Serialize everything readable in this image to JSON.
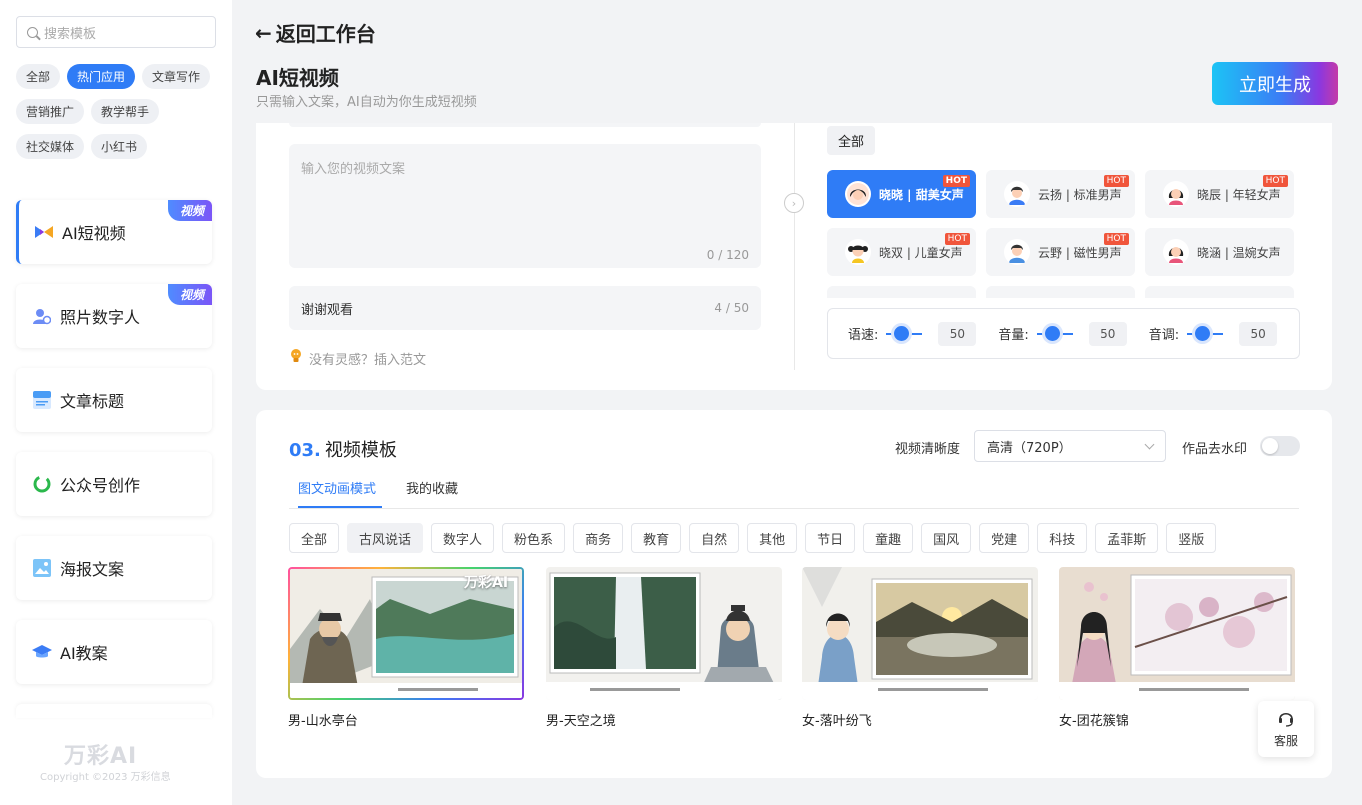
{
  "sidebar": {
    "search_placeholder": "搜索模板",
    "categories": [
      {
        "label": "全部",
        "active": false
      },
      {
        "label": "热门应用",
        "active": true
      },
      {
        "label": "文章写作",
        "active": false
      },
      {
        "label": "营销推广",
        "active": false
      },
      {
        "label": "教学帮手",
        "active": false
      },
      {
        "label": "社交媒体",
        "active": false
      },
      {
        "label": "小红书",
        "active": false
      }
    ],
    "tools": [
      {
        "label": "AI短视频",
        "badge": "视频",
        "icon": "video-icon",
        "active": true
      },
      {
        "label": "照片数字人",
        "badge": "视频",
        "icon": "digital-human-icon",
        "active": false
      },
      {
        "label": "文章标题",
        "badge": "",
        "icon": "title-icon",
        "active": false
      },
      {
        "label": "公众号创作",
        "badge": "",
        "icon": "wechat-icon",
        "active": false
      },
      {
        "label": "海报文案",
        "badge": "",
        "icon": "poster-icon",
        "active": false
      },
      {
        "label": "AI教案",
        "badge": "",
        "icon": "graduation-cap-icon",
        "active": false
      }
    ],
    "brand": "万彩AI",
    "copyright": "Copyright ©2023 万彩信息"
  },
  "header": {
    "back_label": "返回工作台",
    "title": "AI短视频",
    "subtitle": "只需输入文案，AI自动为你生成短视频",
    "generate_label": "立即生成"
  },
  "script_panel": {
    "text_placeholder": "输入您的视频文案",
    "text_count": "0 / 120",
    "ending_text": "谢谢观看",
    "ending_count": "4 / 50",
    "inspiration": "没有灵感？插入范文"
  },
  "voice_panel": {
    "filter_all": "全部",
    "voices": [
      {
        "label": "晓晓 | 甜美女声",
        "hot": "HOT",
        "gender": "female",
        "selected": true
      },
      {
        "label": "云扬 | 标准男声",
        "hot": "HOT",
        "gender": "male",
        "selected": false
      },
      {
        "label": "晓辰 | 年轻女声",
        "hot": "HOT",
        "gender": "female",
        "selected": false
      },
      {
        "label": "晓双 | 儿童女声",
        "hot": "HOT",
        "gender": "child",
        "selected": false
      },
      {
        "label": "云野 | 磁性男声",
        "hot": "HOT",
        "gender": "male",
        "selected": false
      },
      {
        "label": "晓涵 | 温婉女声",
        "hot": "",
        "gender": "female",
        "selected": false
      }
    ],
    "speed_label": "语速:",
    "speed_value": "50",
    "volume_label": "音量:",
    "volume_value": "50",
    "pitch_label": "音调:",
    "pitch_value": "50"
  },
  "template_section": {
    "number": "03.",
    "title": "视频模板",
    "resolution_label": "视频清晰度",
    "resolution_value": "高清（720P）",
    "watermark_label": "作品去水印",
    "watermark_on": false,
    "tabs": [
      {
        "label": "图文动画模式",
        "active": true
      },
      {
        "label": "我的收藏",
        "active": false
      }
    ],
    "filters": [
      {
        "label": "全部",
        "active": false
      },
      {
        "label": "古风说话",
        "active": true
      },
      {
        "label": "数字人",
        "active": false
      },
      {
        "label": "粉色系",
        "active": false
      },
      {
        "label": "商务",
        "active": false
      },
      {
        "label": "教育",
        "active": false
      },
      {
        "label": "自然",
        "active": false
      },
      {
        "label": "其他",
        "active": false
      },
      {
        "label": "节日",
        "active": false
      },
      {
        "label": "童趣",
        "active": false
      },
      {
        "label": "国风",
        "active": false
      },
      {
        "label": "党建",
        "active": false
      },
      {
        "label": "科技",
        "active": false
      },
      {
        "label": "孟菲斯",
        "active": false
      },
      {
        "label": "竖版",
        "active": false
      }
    ],
    "templates": [
      {
        "caption": "男-山水亭台",
        "selected": true,
        "watermark": "万彩AI"
      },
      {
        "caption": "男-天空之境",
        "selected": false,
        "watermark": ""
      },
      {
        "caption": "女-落叶纷飞",
        "selected": false,
        "watermark": ""
      },
      {
        "caption": "女-团花簇锦",
        "selected": false,
        "watermark": ""
      }
    ]
  },
  "support": {
    "label": "客服"
  },
  "colors": {
    "accent": "#2f7cf6",
    "hot": "#f0553b",
    "page_bg": "#f2f3f5"
  }
}
